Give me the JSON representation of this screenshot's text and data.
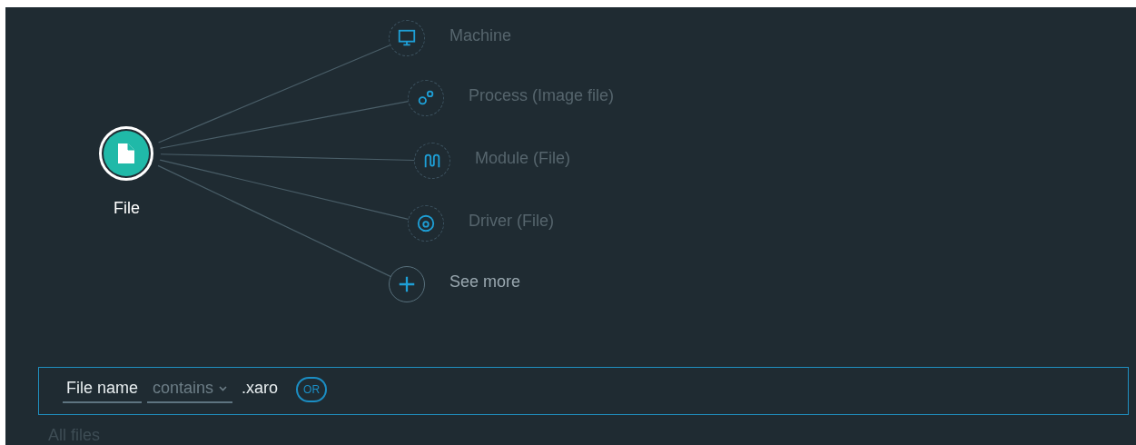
{
  "graph": {
    "root": {
      "label": "File"
    },
    "related": [
      {
        "label": "Machine",
        "kind": "machine"
      },
      {
        "label": "Process (Image file)",
        "kind": "process"
      },
      {
        "label": "Module (File)",
        "kind": "module"
      },
      {
        "label": "Driver (File)",
        "kind": "driver"
      },
      {
        "label": "See more",
        "kind": "more"
      }
    ]
  },
  "filter": {
    "field": "File name",
    "operator": "contains",
    "value": ".xaro",
    "or_button": "OR"
  },
  "footer": "All files"
}
